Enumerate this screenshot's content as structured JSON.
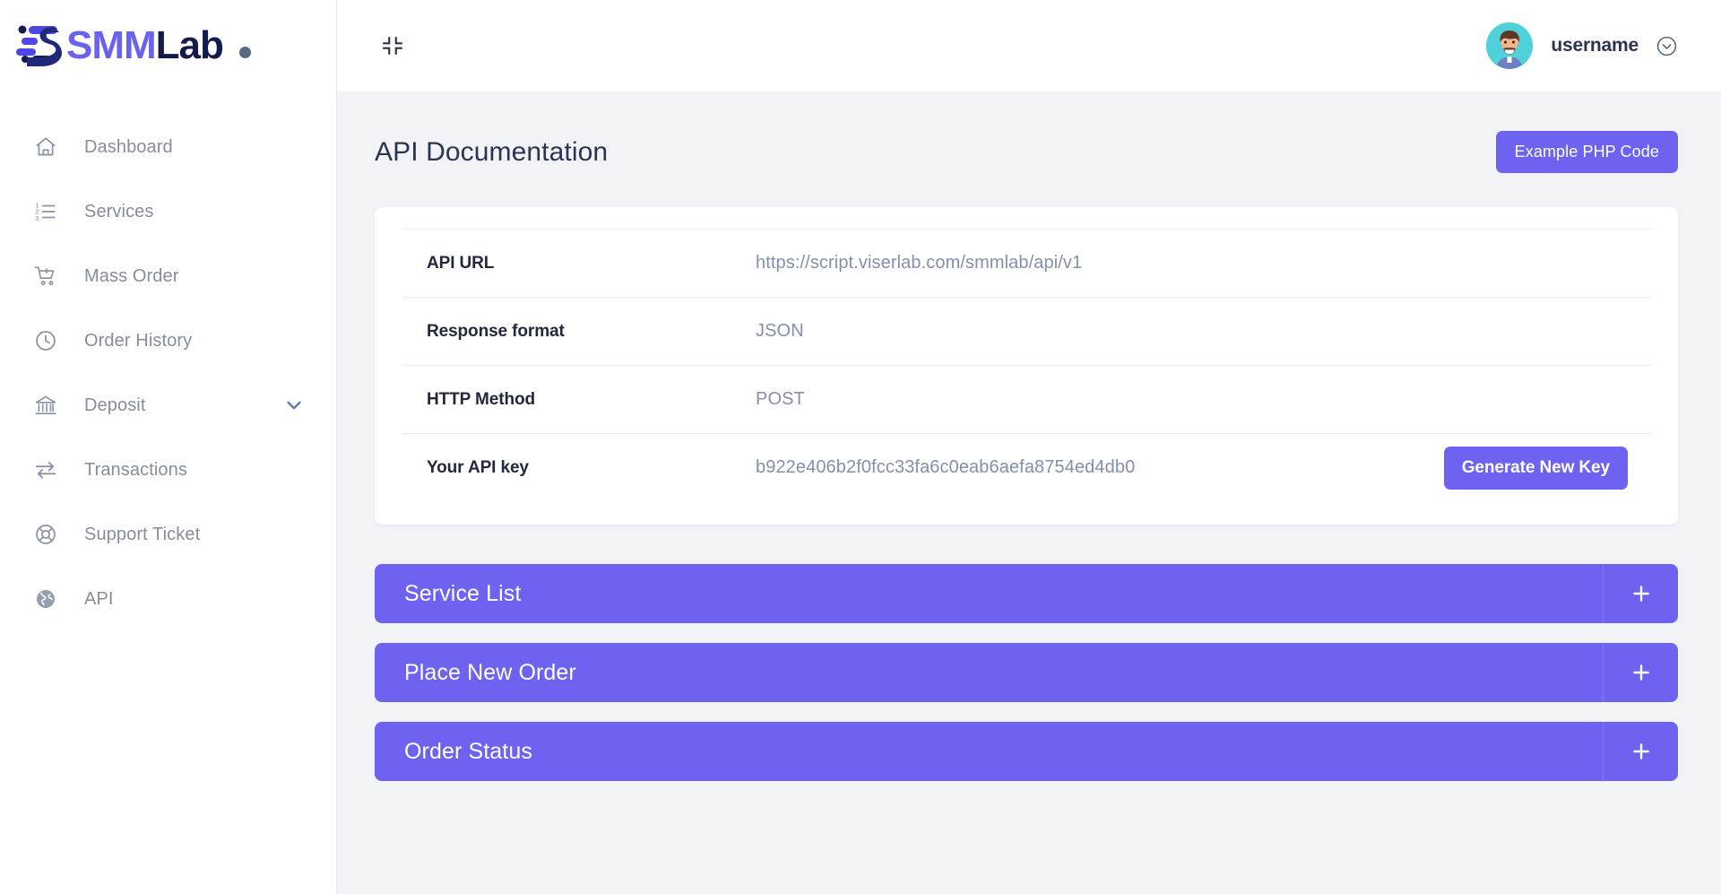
{
  "brand": {
    "name_part1": "SMM",
    "name_part2": "Lab",
    "logo_icon": "smmlab-logo-mark",
    "accent_color": "#6a63f0",
    "dark_color": "#131a4d"
  },
  "sidebar": {
    "items": [
      {
        "label": "Dashboard",
        "icon": "home-icon"
      },
      {
        "label": "Services",
        "icon": "list-ol-icon"
      },
      {
        "label": "Mass Order",
        "icon": "cart-plus-icon"
      },
      {
        "label": "Order History",
        "icon": "clock-icon"
      },
      {
        "label": "Deposit",
        "icon": "bank-icon",
        "caret": "chevron-down-icon"
      },
      {
        "label": "Transactions",
        "icon": "exchange-arrows-icon"
      },
      {
        "label": "Support Ticket",
        "icon": "life-ring-icon"
      },
      {
        "label": "API",
        "icon": "globe-icon"
      }
    ]
  },
  "topbar": {
    "collapse_icon": "compress-icon",
    "avatar_icon": "user-avatar",
    "username": "username",
    "caret_icon": "chevron-down-circle-icon"
  },
  "page": {
    "title": "API Documentation",
    "example_button": "Example PHP Code",
    "accent_color": "#6d63f0"
  },
  "info_table": {
    "rows": [
      {
        "label": "API URL",
        "value": "https://script.viserlab.com/smmlab/api/v1"
      },
      {
        "label": "Response format",
        "value": "JSON"
      },
      {
        "label": "HTTP Method",
        "value": "POST"
      },
      {
        "label": "Your API key",
        "value": "b922e406b2f0fcc33fa6c0eab6aefa8754ed4db0",
        "action": "Generate New Key"
      }
    ]
  },
  "accordion": {
    "toggle_icon": "plus-icon",
    "items": [
      {
        "title": "Service List"
      },
      {
        "title": "Place New Order"
      },
      {
        "title": "Order Status"
      }
    ]
  }
}
